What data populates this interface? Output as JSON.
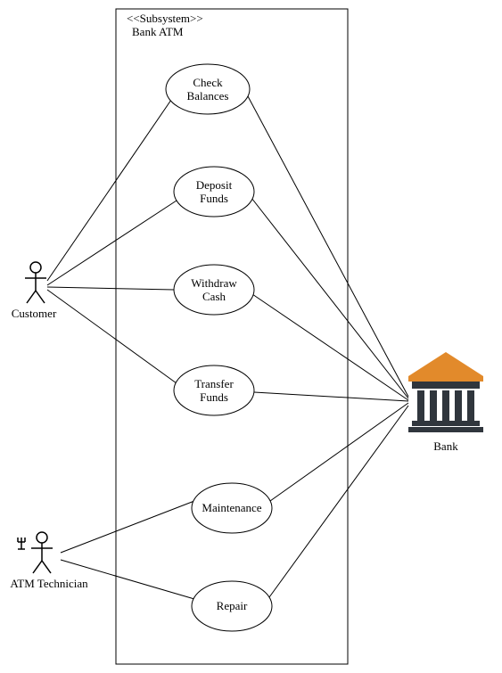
{
  "system": {
    "stereotype": "<<Subsystem>>",
    "name": "Bank ATM"
  },
  "actors": {
    "customer": {
      "label": "Customer"
    },
    "technician": {
      "label": "ATM Technician"
    },
    "bank": {
      "label": "Bank"
    }
  },
  "usecases": {
    "check_balances": {
      "line1": "Check",
      "line2": "Balances"
    },
    "deposit_funds": {
      "line1": "Deposit",
      "line2": "Funds"
    },
    "withdraw_cash": {
      "line1": "Withdraw",
      "line2": "Cash"
    },
    "transfer_funds": {
      "line1": "Transfer",
      "line2": "Funds"
    },
    "maintenance": {
      "line1": "Maintenance"
    },
    "repair": {
      "line1": "Repair"
    }
  },
  "colors": {
    "stroke": "#000000",
    "bank_roof": "#e28a2b",
    "bank_body": "#30363d"
  },
  "chart_data": {
    "type": "uml-use-case",
    "system_boundary": "Bank ATM",
    "stereotype": "<<Subsystem>>",
    "actors": [
      "Customer",
      "ATM Technician",
      "Bank"
    ],
    "use_cases": [
      "Check Balances",
      "Deposit Funds",
      "Withdraw Cash",
      "Transfer Funds",
      "Maintenance",
      "Repair"
    ],
    "associations": [
      {
        "actor": "Customer",
        "use_case": "Check Balances"
      },
      {
        "actor": "Customer",
        "use_case": "Deposit Funds"
      },
      {
        "actor": "Customer",
        "use_case": "Withdraw Cash"
      },
      {
        "actor": "Customer",
        "use_case": "Transfer Funds"
      },
      {
        "actor": "ATM Technician",
        "use_case": "Maintenance"
      },
      {
        "actor": "ATM Technician",
        "use_case": "Repair"
      },
      {
        "actor": "Bank",
        "use_case": "Check Balances"
      },
      {
        "actor": "Bank",
        "use_case": "Deposit Funds"
      },
      {
        "actor": "Bank",
        "use_case": "Withdraw Cash"
      },
      {
        "actor": "Bank",
        "use_case": "Transfer Funds"
      },
      {
        "actor": "Bank",
        "use_case": "Maintenance"
      },
      {
        "actor": "Bank",
        "use_case": "Repair"
      }
    ]
  }
}
